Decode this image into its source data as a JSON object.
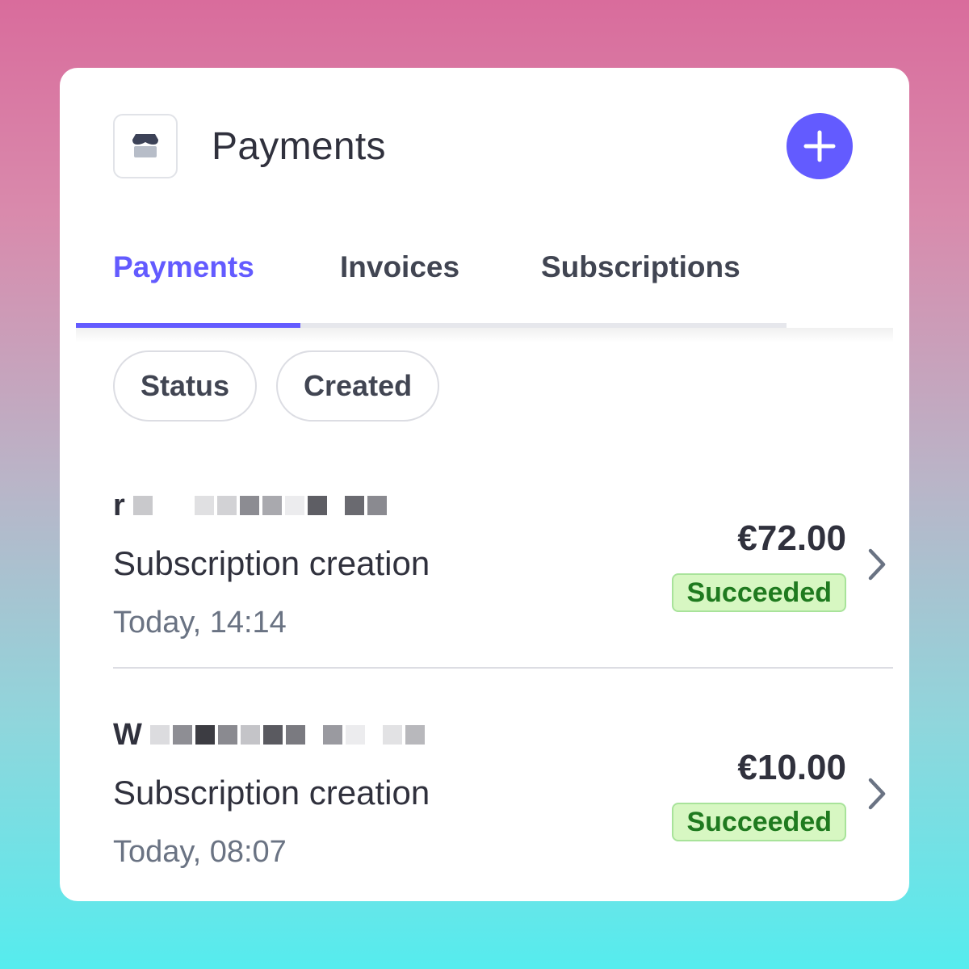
{
  "header": {
    "title": "Payments",
    "icon": "store-icon",
    "add_button_icon": "plus-icon"
  },
  "tabs": [
    {
      "label": "Payments",
      "active": true
    },
    {
      "label": "Invoices",
      "active": false
    },
    {
      "label": "Subscriptions",
      "active": false
    }
  ],
  "filters": [
    {
      "label": "Status"
    },
    {
      "label": "Created"
    }
  ],
  "payments": [
    {
      "customer_initial": "r",
      "customer_redacted": true,
      "description": "Subscription creation",
      "timestamp": "Today, 14:14",
      "amount": "€72.00",
      "status": "Succeeded"
    },
    {
      "customer_initial": "W",
      "customer_redacted": true,
      "description": "Subscription creation",
      "timestamp": "Today, 08:07",
      "amount": "€10.00",
      "status": "Succeeded"
    }
  ],
  "colors": {
    "accent": "#635bff",
    "success_bg": "#d7f7c2",
    "success_text": "#1f7a1f",
    "text_primary": "#30313d",
    "text_secondary": "#6a7383"
  }
}
